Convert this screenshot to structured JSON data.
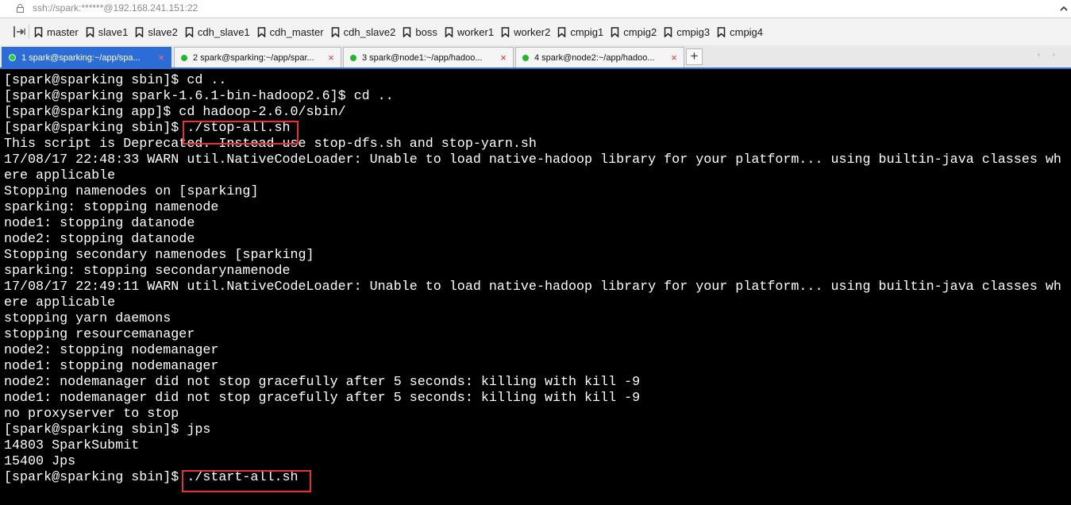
{
  "address_bar": {
    "url": "ssh://spark:******@192.168.241.151:22"
  },
  "bookmarks": [
    {
      "label": "master"
    },
    {
      "label": "slave1"
    },
    {
      "label": "slave2"
    },
    {
      "label": "cdh_slave1"
    },
    {
      "label": "cdh_master"
    },
    {
      "label": "cdh_slave2"
    },
    {
      "label": "boss"
    },
    {
      "label": "worker1"
    },
    {
      "label": "worker2"
    },
    {
      "label": "cmpig1"
    },
    {
      "label": "cmpig2"
    },
    {
      "label": "cmpig3"
    },
    {
      "label": "cmpig4"
    }
  ],
  "tabs": [
    {
      "label": "1 spark@sparking:~/app/spa...",
      "close": "×",
      "active": true
    },
    {
      "label": "2 spark@sparking:~/app/spar...",
      "close": "×",
      "active": false
    },
    {
      "label": "3 spark@node1:~/app/hadoo...",
      "close": "×",
      "active": false
    },
    {
      "label": "4 spark@node2:~/app/hadoo...",
      "close": "×",
      "active": false
    }
  ],
  "tab_add": "+",
  "tab_scroll": "‹ ›",
  "terminal": {
    "lines": [
      "[spark@sparking sbin]$ cd ..",
      "[spark@sparking spark-1.6.1-bin-hadoop2.6]$ cd ..",
      "[spark@sparking app]$ cd hadoop-2.6.0/sbin/",
      "[spark@sparking sbin]$ ./stop-all.sh",
      "This script is Deprecated. Instead use stop-dfs.sh and stop-yarn.sh",
      "17/08/17 22:48:33 WARN util.NativeCodeLoader: Unable to load native-hadoop library for your platform... using builtin-java classes wh",
      "ere applicable",
      "Stopping namenodes on [sparking]",
      "sparking: stopping namenode",
      "node1: stopping datanode",
      "node2: stopping datanode",
      "Stopping secondary namenodes [sparking]",
      "sparking: stopping secondarynamenode",
      "17/08/17 22:49:11 WARN util.NativeCodeLoader: Unable to load native-hadoop library for your platform... using builtin-java classes wh",
      "ere applicable",
      "stopping yarn daemons",
      "stopping resourcemanager",
      "node2: stopping nodemanager",
      "node1: stopping nodemanager",
      "node2: nodemanager did not stop gracefully after 5 seconds: killing with kill -9",
      "node1: nodemanager did not stop gracefully after 5 seconds: killing with kill -9",
      "no proxyserver to stop",
      "[spark@sparking sbin]$ jps",
      "14803 SparkSubmit",
      "15400 Jps",
      "[spark@sparking sbin]$ ./start-all.sh"
    ],
    "colors": {
      "background": "#000000",
      "text": "#ffffff",
      "highlight": "#e3322f"
    }
  }
}
